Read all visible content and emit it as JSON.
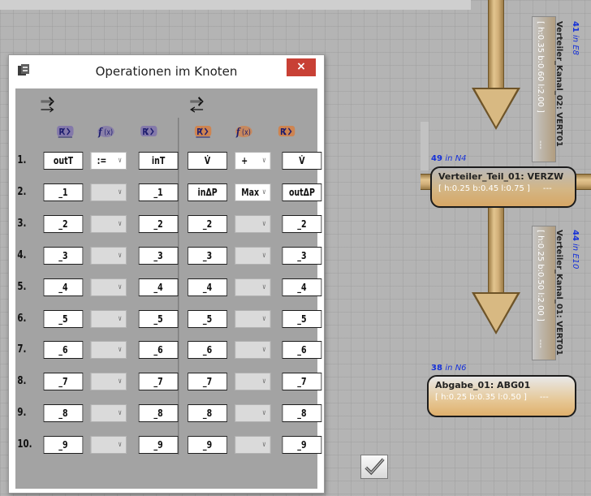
{
  "canvas": {
    "nodes": [
      {
        "tag_num": "49",
        "tag_text": "in N4",
        "name": "Verteiler_Teil_01: VERZW",
        "dims": "[ h:0.25 b:0.45 l:0.75 ]",
        "dash": "---"
      },
      {
        "tag_num": "38",
        "tag_text": "in N6",
        "name": "Abgabe_01: ABG01",
        "dims": "[ h:0.25 b:0.35 l:0.50 ]",
        "dash": "---"
      }
    ],
    "canals": [
      {
        "tag_num": "41",
        "tag_text": "in E8",
        "name": "Verteiler_Kanal_02: VERT01",
        "dims": "[ h:0.35 b:0.60 l:2.00 ]",
        "dash": "---"
      },
      {
        "tag_num": "44",
        "tag_text": "in E10",
        "name": "Verteiler_Kanal_01: VERT01",
        "dims": "[ h:0.25 b:0.50 l:2.00 ]",
        "dash": "---"
      }
    ]
  },
  "dialog": {
    "title": "Operationen im Knoten",
    "close_label": "×",
    "icons": {
      "forward": "forward-arrows-icon",
      "backward": "backward-arrows-icon",
      "param": "param-icon",
      "func": "function-icon",
      "result": "result-icon",
      "confirm": "confirm-check-icon"
    },
    "rows": [
      {
        "num": "1.",
        "fwd_in": "outT",
        "fwd_op": ":=",
        "fwd_out": "inT",
        "bwd_in": "V̇",
        "bwd_op": "+",
        "bwd_out": "V̇"
      },
      {
        "num": "2.",
        "fwd_in": "_1",
        "fwd_op": "",
        "fwd_out": "_1",
        "bwd_in": "inΔP",
        "bwd_op": "Max",
        "bwd_out": "outΔP"
      },
      {
        "num": "3.",
        "fwd_in": "_2",
        "fwd_op": "",
        "fwd_out": "_2",
        "bwd_in": "_2",
        "bwd_op": "",
        "bwd_out": "_2"
      },
      {
        "num": "4.",
        "fwd_in": "_3",
        "fwd_op": "",
        "fwd_out": "_3",
        "bwd_in": "_3",
        "bwd_op": "",
        "bwd_out": "_3"
      },
      {
        "num": "5.",
        "fwd_in": "_4",
        "fwd_op": "",
        "fwd_out": "_4",
        "bwd_in": "_4",
        "bwd_op": "",
        "bwd_out": "_4"
      },
      {
        "num": "6.",
        "fwd_in": "_5",
        "fwd_op": "",
        "fwd_out": "_5",
        "bwd_in": "_5",
        "bwd_op": "",
        "bwd_out": "_5"
      },
      {
        "num": "7.",
        "fwd_in": "_6",
        "fwd_op": "",
        "fwd_out": "_6",
        "bwd_in": "_6",
        "bwd_op": "",
        "bwd_out": "_6"
      },
      {
        "num": "8.",
        "fwd_in": "_7",
        "fwd_op": "",
        "fwd_out": "_7",
        "bwd_in": "_7",
        "bwd_op": "",
        "bwd_out": "_7"
      },
      {
        "num": "9.",
        "fwd_in": "_8",
        "fwd_op": "",
        "fwd_out": "_8",
        "bwd_in": "_8",
        "bwd_op": "",
        "bwd_out": "_8"
      },
      {
        "num": "10.",
        "fwd_in": "_9",
        "fwd_op": "",
        "fwd_out": "_9",
        "bwd_in": "_9",
        "bwd_op": "",
        "bwd_out": "_9"
      }
    ]
  },
  "colors": {
    "close": "#c84035",
    "client_bg": "#a3a3a3",
    "tag_blue": "#1530d8",
    "pipe": "#d8b982"
  }
}
